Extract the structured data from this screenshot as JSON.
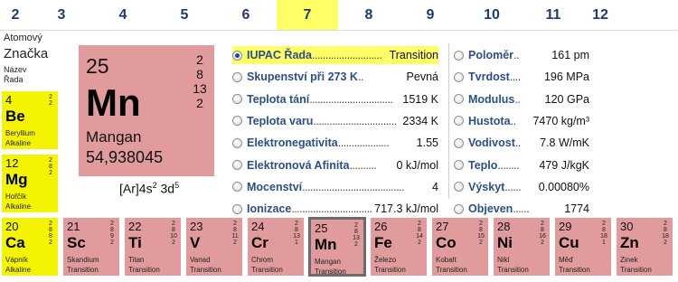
{
  "header": {
    "columns": [
      {
        "label": "2"
      },
      {
        "label": "3"
      },
      {
        "label": "4"
      },
      {
        "label": "5"
      },
      {
        "label": "6"
      },
      {
        "label": "7"
      },
      {
        "label": "8"
      },
      {
        "label": "9"
      },
      {
        "label": "10"
      },
      {
        "label": "11"
      },
      {
        "label": "12"
      }
    ],
    "selected_column": "7"
  },
  "legend": {
    "number": "Atomový",
    "symbol": "Značka",
    "name": "Název",
    "series": "Řada"
  },
  "left_tiles": [
    {
      "num": "4",
      "sym": "Be",
      "name": "Beryllium",
      "series": "Alkaline",
      "shells": [
        "2",
        "2"
      ]
    },
    {
      "num": "12",
      "sym": "Mg",
      "name": "Hořčík",
      "series": "Alkaline",
      "shells": [
        "2",
        "8",
        "2"
      ]
    },
    {
      "num": "20",
      "sym": "Ca",
      "name": "Vápník",
      "series": "Alkaline",
      "shells": [
        "2",
        "8",
        "8",
        "2"
      ]
    }
  ],
  "row4_tiles": [
    {
      "num": "21",
      "sym": "Sc",
      "name": "Skandium",
      "series": "Transition",
      "shells": [
        "2",
        "8",
        "9",
        "2"
      ]
    },
    {
      "num": "22",
      "sym": "Ti",
      "name": "Titan",
      "series": "Transition",
      "shells": [
        "2",
        "8",
        "10",
        "2"
      ]
    },
    {
      "num": "23",
      "sym": "V",
      "name": "Vanad",
      "series": "Transition",
      "shells": [
        "2",
        "8",
        "11",
        "2"
      ]
    },
    {
      "num": "24",
      "sym": "Cr",
      "name": "Chrom",
      "series": "Transition",
      "shells": [
        "2",
        "8",
        "13",
        "1"
      ]
    },
    {
      "num": "25",
      "sym": "Mn",
      "name": "Mangan",
      "series": "Transition",
      "shells": [
        "2",
        "8",
        "13",
        "2"
      ]
    },
    {
      "num": "26",
      "sym": "Fe",
      "name": "Železo",
      "series": "Transition",
      "shells": [
        "2",
        "8",
        "14",
        "2"
      ]
    },
    {
      "num": "27",
      "sym": "Co",
      "name": "Kobalt",
      "series": "Transition",
      "shells": [
        "2",
        "8",
        "15",
        "2"
      ]
    },
    {
      "num": "28",
      "sym": "Ni",
      "name": "Nikl",
      "series": "Transition",
      "shells": [
        "2",
        "8",
        "16",
        "2"
      ]
    },
    {
      "num": "29",
      "sym": "Cu",
      "name": "Měď",
      "series": "Transition",
      "shells": [
        "2",
        "8",
        "18",
        "1"
      ]
    },
    {
      "num": "30",
      "sym": "Zn",
      "name": "Zinek",
      "series": "Transition",
      "shells": [
        "2",
        "8",
        "18",
        "2"
      ]
    }
  ],
  "selected_element": {
    "number": "25",
    "symbol": "Mn",
    "name": "Mangan",
    "mass": "54,938045",
    "shells": [
      "2",
      "8",
      "13",
      "2"
    ],
    "config_core": "[Ar]4s",
    "config_sup1": "2",
    "config_mid": " 3d",
    "config_sup2": "5"
  },
  "properties_left": [
    {
      "label": "IUPAC Řada",
      "dots": "..........................",
      "value": "Transition",
      "checked": true
    },
    {
      "label": "Skupenství při 273 K",
      "dots": "..",
      "value": "Pevná",
      "checked": false
    },
    {
      "label": "Teplota tání",
      "dots": "...............................",
      "value": "1519 K",
      "checked": false
    },
    {
      "label": "Teplota varu",
      "dots": "...............................",
      "value": "2334 K",
      "checked": false
    },
    {
      "label": "Elektronegativita",
      "dots": "...................",
      "value": "1.55",
      "checked": false
    },
    {
      "label": "Elektronová Afinita",
      "dots": "..........",
      "value": "0 kJ/mol",
      "checked": false
    },
    {
      "label": "Mocenství",
      "dots": "......................................",
      "value": "4",
      "checked": false
    },
    {
      "label": "Ionizace",
      "dots": "..............................",
      "value": "717.3 kJ/mol",
      "checked": false
    }
  ],
  "properties_right": [
    {
      "label": "Poloměr",
      "dots": "..",
      "value": "161 pm"
    },
    {
      "label": "Tvrdost",
      "dots": "....",
      "value": "196 MPa"
    },
    {
      "label": "Modulus",
      "dots": "..",
      "value": "120 GPa"
    },
    {
      "label": "Hustota",
      "dots": "..",
      "value": "7470 kg/m³"
    },
    {
      "label": "Vodivost",
      "dots": "..",
      "value": "7.8 W/mK"
    },
    {
      "label": "Teplo",
      "dots": "........",
      "value": "479 J/kgK"
    },
    {
      "label": "Výskyt",
      "dots": "......",
      "value": "0.00080%"
    },
    {
      "label": "Objeven",
      "dots": "......",
      "value": "1774"
    }
  ],
  "colors": {
    "alkaline": "#f4f400",
    "transition": "#e29b9c",
    "selected_highlight": "#ffff66",
    "header_text": "#1f3b6f",
    "label_text": "#2b4f86"
  }
}
